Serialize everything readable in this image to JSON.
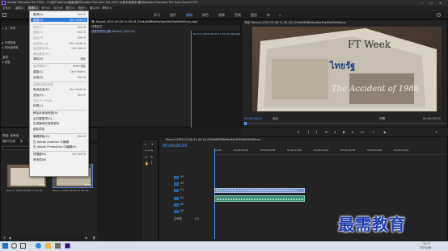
{
  "window": {
    "title": "Adobe Premiere Pro 2020 - C:\\用户\\Admin\\桌面\\素材\\Adobe Premiere Pro 2020 从新手到高手\\素材\\Adobe Premiere Pro Auto-Save\\?????",
    "controls": [
      "—",
      "☐",
      "✕"
    ]
  },
  "menu": [
    "文件(F)",
    "编辑(E)",
    "剪辑(C)",
    "序列(S)",
    "标记(M)",
    "图形(G)",
    "视图(V)",
    "窗口(W)",
    "帮助(H)"
  ],
  "workspaces": [
    "学习",
    "组件",
    "编辑",
    "颜色",
    "效果",
    "音频",
    "图形",
    "库",
    "»"
  ],
  "edit_menu": {
    "items": [
      {
        "label": "撤消(U)",
        "shortcut": "Ctrl+Z",
        "disabled": false
      },
      {
        "label": "重做(R)",
        "shortcut": "Ctrl+Shift+Z",
        "disabled": true
      },
      {
        "label": "剪切(T)",
        "shortcut": "Ctrl+X",
        "disabled": true
      },
      {
        "label": "复制(Y)",
        "shortcut": "Ctrl+C",
        "disabled": true
      },
      {
        "label": "粘贴(P)",
        "shortcut": "Ctrl+V",
        "disabled": true
      },
      {
        "label": "粘贴插入(I)",
        "shortcut": "Ctrl+Shift+V",
        "disabled": true
      },
      {
        "label": "粘贴属性(B)...",
        "shortcut": "Ctrl+Alt+V",
        "disabled": true
      },
      {
        "label": "删除属性(R)...",
        "shortcut": "",
        "disabled": true
      },
      {
        "label": "清除(E)",
        "shortcut": "删除",
        "disabled": false
      },
      {
        "label": "波纹删除(T)",
        "shortcut": "Shift+删除",
        "disabled": true
      },
      {
        "label": "重复(C)",
        "shortcut": "Ctrl+Shift+/",
        "disabled": false
      },
      {
        "label": "全选(A)",
        "shortcut": "Ctrl+A",
        "disabled": false
      },
      {
        "label": "选择所有匹配项",
        "shortcut": "",
        "disabled": true
      },
      {
        "label": "取消全选(D)",
        "shortcut": "Ctrl+Shift+A",
        "disabled": false
      },
      {
        "label": "查找(F)...",
        "shortcut": "Ctrl+F",
        "disabled": false
      },
      {
        "label": "查找下一个(N)",
        "shortcut": "",
        "disabled": true
      },
      {
        "label": "标签(L)",
        "shortcut": "",
        "disabled": false
      },
      {
        "label": "移除未使用资源(R)",
        "shortcut": "",
        "disabled": false
      },
      {
        "label": "合并重复项(C)...",
        "shortcut": "",
        "disabled": false
      },
      {
        "label": "生成媒体的音频波形",
        "shortcut": "",
        "disabled": false
      },
      {
        "label": "团队项目",
        "shortcut": "",
        "disabled": false
      },
      {
        "label": "编辑原始(O)",
        "shortcut": "Ctrl+E",
        "disabled": false
      },
      {
        "label": "在 Adobe Audition 中编辑",
        "shortcut": "",
        "disabled": false
      },
      {
        "label": "在 Adobe Photoshop 中编辑(H)",
        "shortcut": "",
        "disabled": false
      },
      {
        "label": "快捷键(K)",
        "shortcut": "Ctrl+Alt+K",
        "disabled": false
      },
      {
        "label": "首选项(N)",
        "shortcut": "",
        "disabled": false
      }
    ],
    "highlighted": "重做(R)"
  },
  "source_panel": {
    "tab": "源: Record_2022-03-06-11-49-16_92e4e84f86e9ac6ae39e09e09e9f4cca.mp4",
    "mixer": "效果控件",
    "audio": "音频剪辑混合器: Record_2022-03..."
  },
  "sequence_label": "Record_2022-03-06-11-49-16_92e4e84f86e9...",
  "program": {
    "tab": "节目: Record_2022-03-06-11-49-16_92e4e84f86e9ac6ae39e09e09e9f4cca",
    "timecode": "00;00;00;00",
    "fit": "适合",
    "quality": "完整",
    "duration": "00;00;32;02",
    "ruler_mark": "00;00;15;00"
  },
  "project": {
    "tab": "项目: 未命名",
    "filter_label": "项",
    "media": [
      {
        "name": "Record_2022-03-06-11-49-16...",
        "duration": "32:02"
      },
      {
        "name": "Record_2022-03-06-11-49-16...",
        "duration": "32:02"
      }
    ],
    "tabs": [
      "媒体浏览器",
      "库",
      "信息",
      "效果",
      "标记",
      "历史记录"
    ]
  },
  "timeline": {
    "tab": "Record_2022-03-06-11-49-16_92e4e84f86e9ac6ae39e09e09e9f4cca",
    "timecode": "00;00;00;00",
    "ruler": [
      "00;00",
      "00;00;05;00",
      "00;00;10;00",
      "00;00;15;00",
      "00;00;20;00",
      "00;00;25;00",
      "00;00;30;00",
      "00;00;35;00"
    ],
    "tracks": [
      "V3",
      "V2",
      "V1",
      "A1",
      "A2",
      "A3"
    ],
    "master": "主声道",
    "master_value": "0.0",
    "clip_name": "Record_2022-03-06-11-49-16_92e4e84f86e9ac6ae39e09e09e9f4cca.mp4 [V]"
  },
  "newspaper": {
    "headline": "ไทยรัฐ",
    "script": "The Accident of 1986",
    "masthead": "FT Week"
  },
  "watermark": "最需教育",
  "taskbar": {
    "time": "10:17",
    "date": "2022/3/8"
  }
}
